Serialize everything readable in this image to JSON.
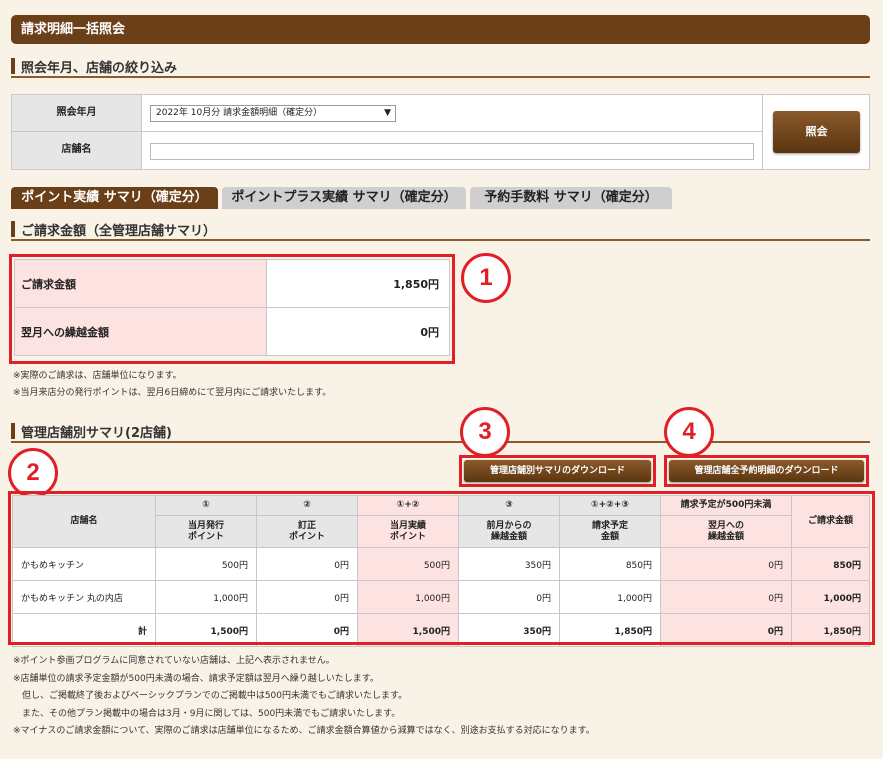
{
  "page_title": "請求明細一括照会",
  "filter_section": {
    "heading": "照会年月、店舗の絞り込み",
    "month_label": "照会年月",
    "month_value": "2022年 10月分 請求金額明細（確定分）",
    "store_label": "店舗名",
    "store_value": "",
    "search_button": "照会"
  },
  "tabs": [
    {
      "label": "ポイント実績 サマリ（確定分）",
      "active": true
    },
    {
      "label": "ポイントプラス実績 サマリ（確定分）",
      "active": false
    },
    {
      "label": "予約手数料 サマリ（確定分）",
      "active": false
    }
  ],
  "billing_section": {
    "heading": "ご請求金額（全管理店舗サマリ）",
    "rows": [
      {
        "label": "ご請求金額",
        "value": "1,850円"
      },
      {
        "label": "翌月への繰越金額",
        "value": "0円"
      }
    ],
    "notes": [
      "※実際のご請求は、店舗単位になります。",
      "※当月来店分の発行ポイントは、翌月6日締めにて翌月内にご請求いたします。"
    ]
  },
  "store_section": {
    "heading": "管理店舗別サマリ(2店舗)",
    "download_summary_button": "管理店舗別サマリのダウンロード",
    "download_detail_button": "管理店舗全予約明細のダウンロード",
    "headers": {
      "store": "店舗名",
      "c1_top": "①",
      "c1_bottom": "当月発行\nポイント",
      "c2_top": "②",
      "c2_bottom": "訂正\nポイント",
      "c3_top": "①+②",
      "c3_bottom": "当月実績\nポイント",
      "c4_top": "③",
      "c4_bottom": "前月からの\n繰越金額",
      "c5_top": "①+②+③",
      "c5_bottom": "請求予定\n金額",
      "c6_top": "請求予定が500円未満",
      "c6_bottom": "翌月への\n繰越金額",
      "c7": "ご請求金額"
    },
    "rows": [
      {
        "name": "かもめキッチン",
        "c1": "500円",
        "c2": "0円",
        "c3": "500円",
        "c4": "350円",
        "c5": "850円",
        "c6": "0円",
        "c7": "850円"
      },
      {
        "name": "かもめキッチン 丸の内店",
        "c1": "1,000円",
        "c2": "0円",
        "c3": "1,000円",
        "c4": "0円",
        "c5": "1,000円",
        "c6": "0円",
        "c7": "1,000円"
      }
    ],
    "total": {
      "name": "計",
      "c1": "1,500円",
      "c2": "0円",
      "c3": "1,500円",
      "c4": "350円",
      "c5": "1,850円",
      "c6": "0円",
      "c7": "1,850円"
    },
    "notes": [
      "※ポイント参画プログラムに同意されていない店舗は、上記へ表示されません。",
      "※店舗単位の請求予定金額が500円未満の場合、請求予定額は翌月へ繰り越しいたします。",
      "　但し、ご掲載終了後およびベーシックプランでのご掲載中は500円未満でもご請求いたします。",
      "　また、その他プラン掲載中の場合は3月・9月に関しては、500円未満でもご請求いたします。",
      "※マイナスのご請求金額について、実際のご請求は店舗単位になるため、ご請求金額合算値から減算ではなく、別途お支払する対応になります。"
    ]
  },
  "annotations": [
    "1",
    "2",
    "3",
    "4"
  ],
  "colors": {
    "brown": "#6b3f17",
    "highlight_red": "#e01f26",
    "pink": "#fde2e2",
    "background": "#f8f3e6"
  }
}
